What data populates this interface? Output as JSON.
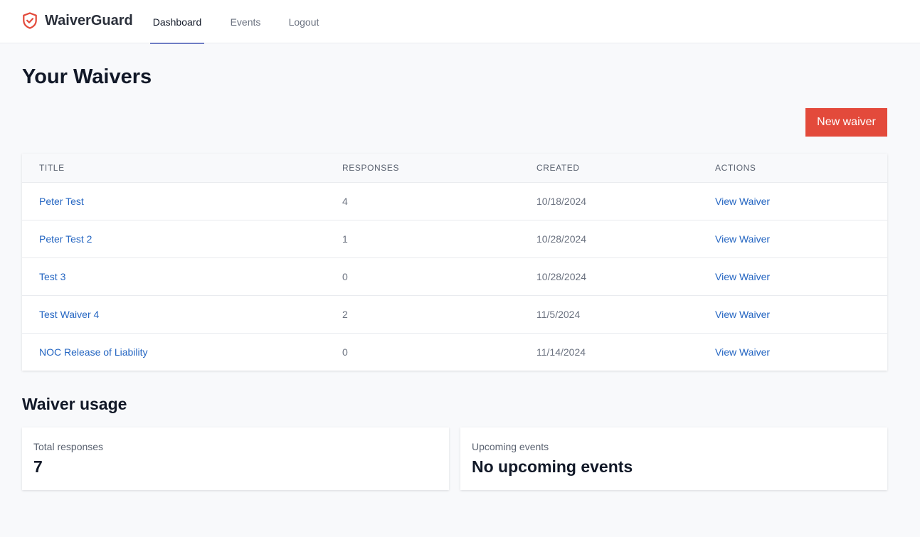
{
  "brand": {
    "name": "WaiverGuard",
    "icon": "shield-check-icon",
    "accent": "#e34a3b"
  },
  "nav": {
    "items": [
      {
        "label": "Dashboard",
        "active": true
      },
      {
        "label": "Events",
        "active": false
      },
      {
        "label": "Logout",
        "active": false
      }
    ]
  },
  "page": {
    "title": "Your Waivers",
    "new_button_label": "New waiver"
  },
  "table": {
    "columns": [
      "TITLE",
      "RESPONSES",
      "CREATED",
      "ACTIONS"
    ],
    "rows": [
      {
        "title": "Peter Test",
        "responses": "4",
        "created": "10/18/2024",
        "action": "View Waiver"
      },
      {
        "title": "Peter Test 2",
        "responses": "1",
        "created": "10/28/2024",
        "action": "View Waiver"
      },
      {
        "title": "Test 3",
        "responses": "0",
        "created": "10/28/2024",
        "action": "View Waiver"
      },
      {
        "title": "Test Waiver 4",
        "responses": "2",
        "created": "11/5/2024",
        "action": "View Waiver"
      },
      {
        "title": "NOC Release of Liability",
        "responses": "0",
        "created": "11/14/2024",
        "action": "View Waiver"
      }
    ]
  },
  "usage": {
    "title": "Waiver usage",
    "total_label": "Total responses",
    "total_value": "7",
    "upcoming_label": "Upcoming events",
    "upcoming_value": "No upcoming events"
  },
  "colors": {
    "primary_button": "#e34a3b",
    "link": "#2566c2",
    "nav_active_underline": "#6f7dc4"
  }
}
